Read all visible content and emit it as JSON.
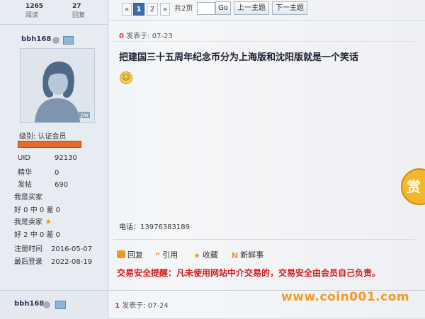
{
  "topstats": {
    "views_value": "1265",
    "views_label": "阅读",
    "replies_value": "27",
    "replies_label": "回复"
  },
  "pagination": {
    "prev": "«",
    "pages": [
      "1",
      "2"
    ],
    "current": "1",
    "next": "»",
    "total_text": "共2页",
    "go_label": "Go",
    "prev_topic": "上一主题",
    "next_topic": "下一主题"
  },
  "post": {
    "username": "bbh168",
    "avatar_badge": "pw",
    "level_text": "级别: 认证会员",
    "profile": [
      {
        "k": "UID",
        "v": "92130"
      },
      {
        "k": "精华",
        "v": "0"
      },
      {
        "k": "发帖",
        "v": "690"
      }
    ],
    "buyer_label": "我是买家",
    "buyer_rating": "好 0 中 0 差 0",
    "seller_label": "我是卖家",
    "seller_rating": "好 2 中 0 差 0",
    "reg_label": "注册时间",
    "reg_value": "2016-05-07",
    "last_label": "最后登录",
    "last_value": "2022-08-19",
    "floor": "0",
    "posted_at": "发表于: 07-23",
    "title": "把建国三十五周年纪念币分为上海版和沈阳版就是一个笑话",
    "reward_label": "赏",
    "phone_text": "电话：13976383189",
    "actions": [
      "回复",
      "引用",
      "收藏",
      "新鲜事"
    ],
    "warning": "交易安全提醒：凡未使用网站中介交易的，交易安全由会员自己负责。"
  },
  "next_post": {
    "username": "bbh168",
    "floor": "1",
    "posted_at": "发表于: 07-24"
  },
  "watermark": "www.coin001.com",
  "colors": {
    "accent": "#3a6ea5",
    "warning": "#d41c1c",
    "level_bar": "#e86a2a",
    "watermark": "#f29b1e"
  }
}
